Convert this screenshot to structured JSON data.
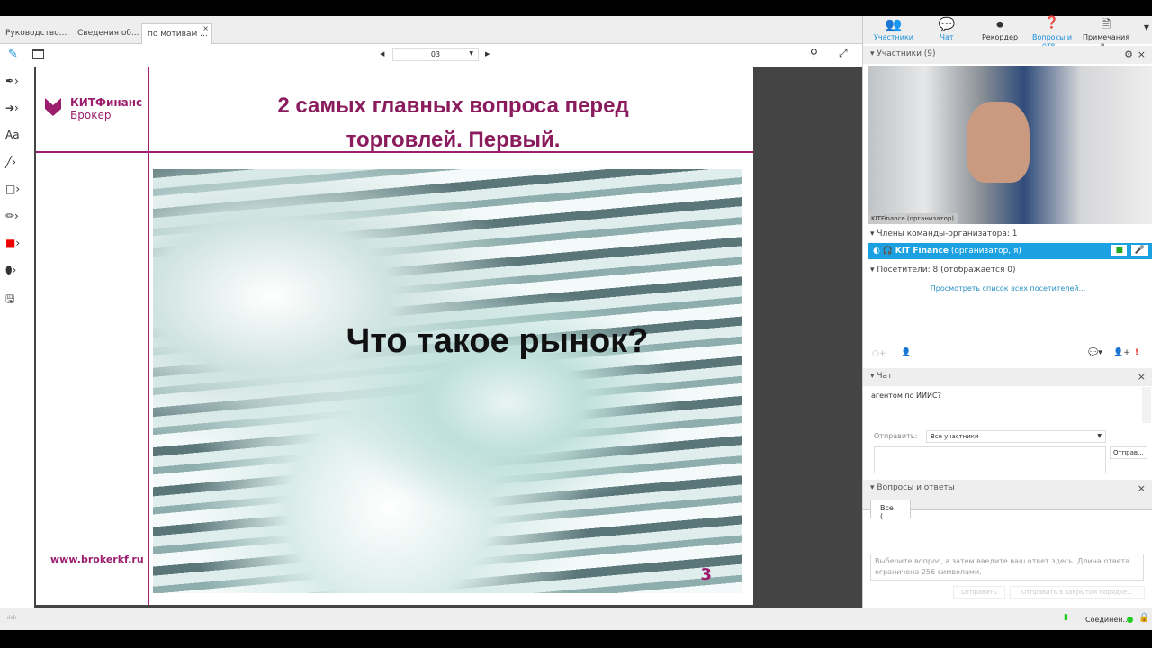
{
  "tabs": [
    {
      "label": "Руководство..."
    },
    {
      "label": "Сведения об..."
    },
    {
      "label": "по мотивам ...",
      "active": true
    }
  ],
  "toolbar": {
    "page": "03"
  },
  "left_tools": [
    "pen",
    "annotate",
    "arrow",
    "text",
    "line",
    "rectangle",
    "highlighter",
    "color",
    "eraser",
    "save"
  ],
  "left_tools_text": {
    "text": "Aa"
  },
  "slide": {
    "logo_main": "КИТФинанс",
    "logo_sub": "Брокер",
    "title_line1": "2 самых главных вопроса перед",
    "title_line2": "торговлей. Первый.",
    "image_text": "Что такое рынок?",
    "website": "www.brokerkf.ru",
    "page_number": "3",
    "accent": "#9b1f6e"
  },
  "topnav": [
    {
      "label": "Участники",
      "icon": "participants-icon"
    },
    {
      "label": "Чат",
      "icon": "chat-icon"
    },
    {
      "label": "Рекордер",
      "icon": "recorder-icon"
    },
    {
      "label": "Вопросы и отв...",
      "icon": "qa-icon"
    },
    {
      "label": "Примечания в...",
      "icon": "notes-icon"
    }
  ],
  "participants": {
    "header": "Участники (9)",
    "video_label": "KITFinance (организатор)",
    "hosts_group": "Члены команды-организатора: 1",
    "host_name": "KIT Finance",
    "host_role": "(организатор, я)",
    "attendees_group": "Посетители: 8 (отображается 0)",
    "view_all": "Просмотреть список всех посетителей...",
    "highlight": "#1ba1e2"
  },
  "chat": {
    "header": "Чат",
    "message": "агентом по ИИИС?",
    "send_to_label": "Отправить:",
    "send_to_value": "Все участники",
    "send_button": "Отправ..."
  },
  "qa": {
    "header": "Вопросы и ответы",
    "tab": "Все (...",
    "placeholder": "Выберите вопрос, а затем введите ваш ответ здесь. Длина ответа ограничена 256 символами.",
    "send": "Отправить",
    "send_private": "Отправить в закрытом порядке..."
  },
  "status": {
    "connection": "Соединен...",
    "logo": "cisco"
  }
}
